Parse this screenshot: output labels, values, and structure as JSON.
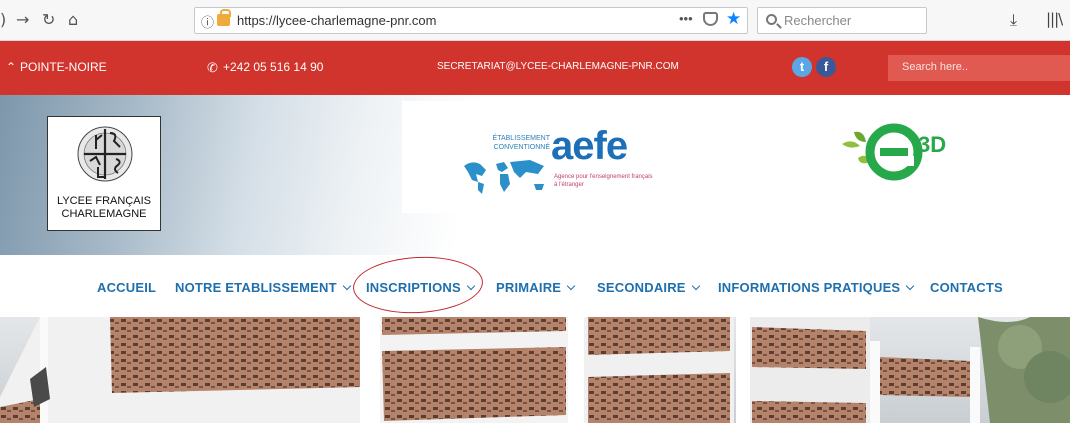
{
  "browser": {
    "back_icon": "back-arrow-icon",
    "forward_icon": "forward-arrow-icon",
    "reload_icon": "reload-icon",
    "home_icon": "home-icon",
    "url": "https://lycee-charlemagne-pnr.com",
    "search_placeholder": "Rechercher"
  },
  "topbar": {
    "city": "POINTE-NOIRE",
    "phone": "+242 05 516 14 90",
    "email": "SECRETARIAT@LYCEE-CHARLEMAGNE-PNR.COM",
    "search_placeholder": "Search here..",
    "twitter_glyph": "t",
    "facebook_glyph": "f",
    "colors": {
      "bar": "#d0342c"
    }
  },
  "logos": {
    "lycee_line1": "LYCEE FRANÇAIS",
    "lycee_line2": "CHARLEMAGNE",
    "aefe_caption": "ÉTABLISSEMENT CONVENTIONNÉ",
    "aefe_name": "aefe",
    "aefe_sub": "Agence pour l'enseignement français à l'étranger",
    "e3d_label": "3D"
  },
  "nav": {
    "items": [
      {
        "label": "ACCUEIL",
        "has_dropdown": false
      },
      {
        "label": "NOTRE ETABLISSEMENT",
        "has_dropdown": true
      },
      {
        "label": "INSCRIPTIONS",
        "has_dropdown": true,
        "highlighted": true
      },
      {
        "label": "PRIMAIRE",
        "has_dropdown": true
      },
      {
        "label": "SECONDAIRE",
        "has_dropdown": true
      },
      {
        "label": "INFORMATIONS PRATIQUES",
        "has_dropdown": true
      },
      {
        "label": "CONTACTS",
        "has_dropdown": false
      }
    ],
    "colors": {
      "link": "#1e6fae",
      "highlight_circle": "#c0282d"
    }
  }
}
